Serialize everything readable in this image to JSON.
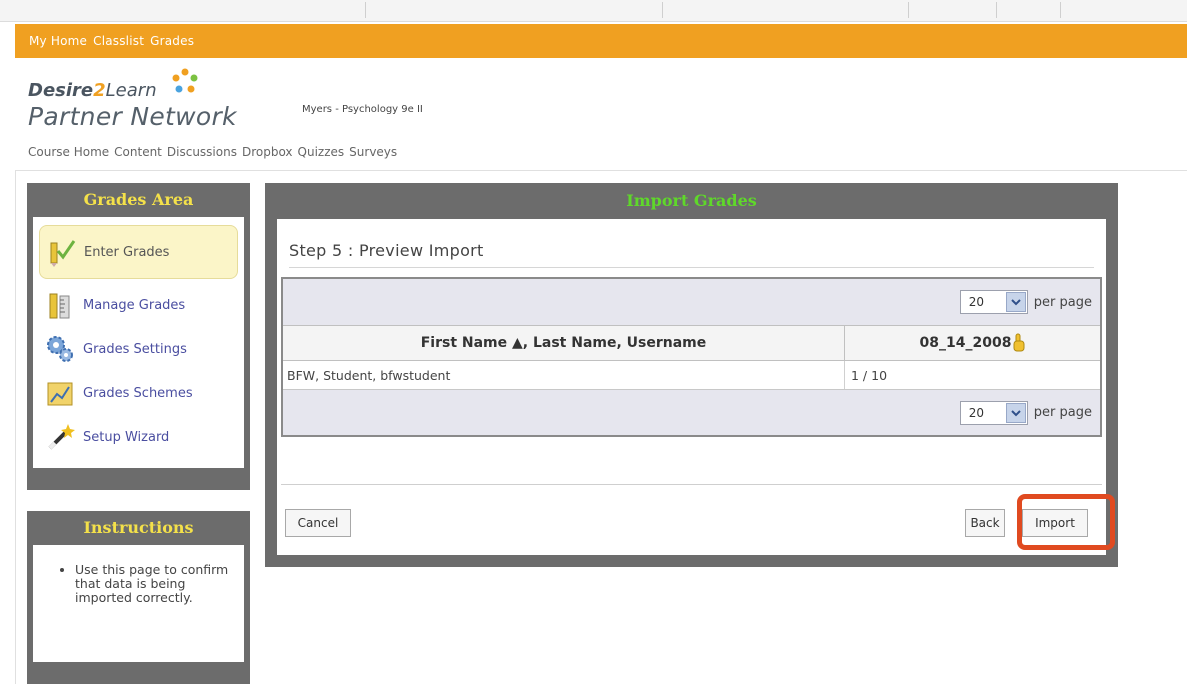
{
  "top_nav": [
    "My Home",
    "Classlist",
    "Grades"
  ],
  "brand": {
    "line1_prefix": "Desire",
    "line1_two": "2",
    "line1_suffix": "Learn",
    "line2": "Partner Network"
  },
  "course_title": "Myers - Psychology 9e II",
  "course_nav": [
    "Course Home",
    "Content",
    "Discussions",
    "Dropbox",
    "Quizzes",
    "Surveys"
  ],
  "sidebar": {
    "title": "Grades Area",
    "items": [
      {
        "label": "Enter Grades",
        "icon": "pencil-check-icon",
        "active": true
      },
      {
        "label": "Manage Grades",
        "icon": "ruler-icon"
      },
      {
        "label": "Grades Settings",
        "icon": "gears-icon"
      },
      {
        "label": "Grades Schemes",
        "icon": "chart-icon"
      },
      {
        "label": "Setup Wizard",
        "icon": "wand-icon"
      }
    ]
  },
  "instructions": {
    "title": "Instructions",
    "text": "Use this page to confirm that data is being imported correctly."
  },
  "main": {
    "title": "Import Grades",
    "step": "Step 5 : Preview Import",
    "per_page_value": "20",
    "per_page_label": "per page",
    "columns": [
      "First Name ▲, Last Name, Username",
      "08_14_2008"
    ],
    "rows": [
      [
        "BFW, Student, bfwstudent",
        "1 / 10"
      ]
    ],
    "buttons": {
      "cancel": "Cancel",
      "back": "Back",
      "import": "Import"
    }
  },
  "colors": {
    "nav_orange": "#f0a021",
    "panel_gray": "#6c6c6c",
    "sidebar_title": "#f4e14a",
    "main_title": "#5fd82a",
    "highlight": "#e04a20"
  }
}
